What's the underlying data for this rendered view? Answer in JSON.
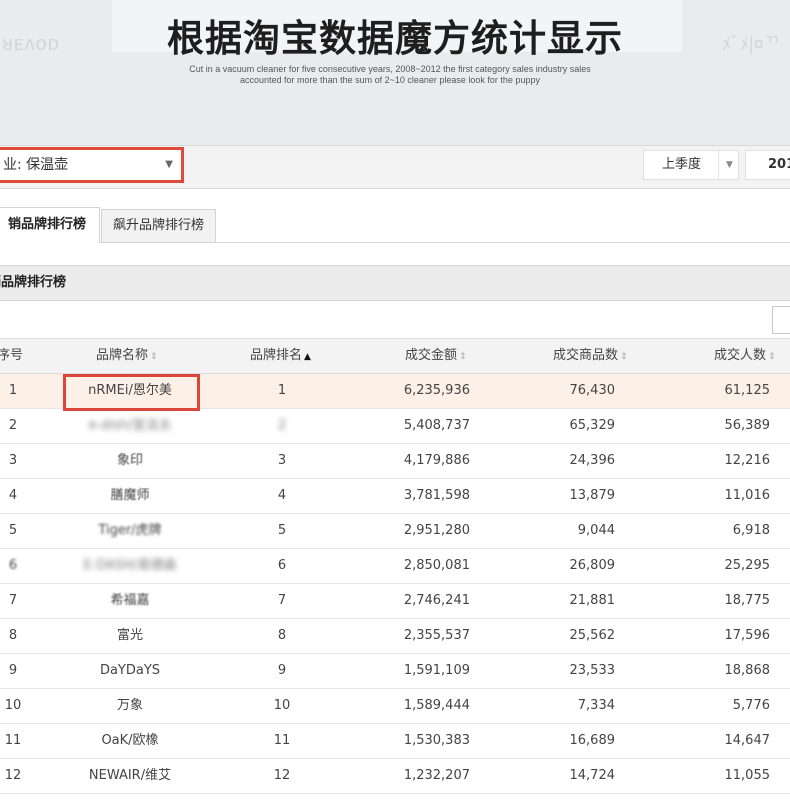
{
  "banner": {
    "title": "根据淘宝数据魔方统计显示",
    "subtitle_line1": "Cut in a vacuum cleaner for five consecutive years, 2008~2012 the first category sales industry sales",
    "subtitle_line2": "accounted for more than the sum of 2~10 cleaner please look for the puppy",
    "watermark_left": "ᴚᴇʌoᴅ",
    "watermark_right": "ﾒﾞﾒ|¤ᄁ"
  },
  "filters": {
    "industry_label": "业: 保温壶",
    "quarter_label": "上季度",
    "year_label": "201"
  },
  "tabs": [
    {
      "label": "销品牌排行榜",
      "active": true
    },
    {
      "label": "飙升品牌排行榜",
      "active": false
    }
  ],
  "section": {
    "title": "销品牌排行榜"
  },
  "table": {
    "headers": {
      "index": "序号",
      "brand": "品牌名称",
      "rank": "品牌排名",
      "amount": "成交金额",
      "items": "成交商品数",
      "users": "成交人数"
    },
    "sort_icon": "⇕",
    "sort_active_icon": "▲",
    "rows": [
      {
        "index": "1",
        "brand": "nRMEi/恩尔美",
        "rank": "1",
        "amount": "6,235,936",
        "items": "76,430",
        "users": "61,125"
      },
      {
        "index": "2",
        "brand": "e-dish/宜洁太",
        "rank": "2",
        "amount": "5,408,737",
        "items": "65,329",
        "users": "56,389"
      },
      {
        "index": "3",
        "brand": "象印",
        "rank": "3",
        "amount": "4,179,886",
        "items": "24,396",
        "users": "12,216"
      },
      {
        "index": "4",
        "brand": "膳魔师",
        "rank": "4",
        "amount": "3,781,598",
        "items": "13,879",
        "users": "11,016"
      },
      {
        "index": "5",
        "brand": "Tiger/虎牌",
        "rank": "5",
        "amount": "2,951,280",
        "items": "9,044",
        "users": "6,918"
      },
      {
        "index": "6",
        "brand": "E-DASH/易德森",
        "rank": "6",
        "amount": "2,850,081",
        "items": "26,809",
        "users": "25,295"
      },
      {
        "index": "7",
        "brand": "希福嘉",
        "rank": "7",
        "amount": "2,746,241",
        "items": "21,881",
        "users": "18,775"
      },
      {
        "index": "8",
        "brand": "富光",
        "rank": "8",
        "amount": "2,355,537",
        "items": "25,562",
        "users": "17,596"
      },
      {
        "index": "9",
        "brand": "DaYDaYS",
        "rank": "9",
        "amount": "1,591,109",
        "items": "23,533",
        "users": "18,868"
      },
      {
        "index": "10",
        "brand": "万象",
        "rank": "10",
        "amount": "1,589,444",
        "items": "7,334",
        "users": "5,776"
      },
      {
        "index": "11",
        "brand": "OaK/欧橡",
        "rank": "11",
        "amount": "1,530,383",
        "items": "16,689",
        "users": "14,647"
      },
      {
        "index": "12",
        "brand": "NEWAIR/维艾",
        "rank": "12",
        "amount": "1,232,207",
        "items": "14,724",
        "users": "11,055"
      }
    ]
  }
}
